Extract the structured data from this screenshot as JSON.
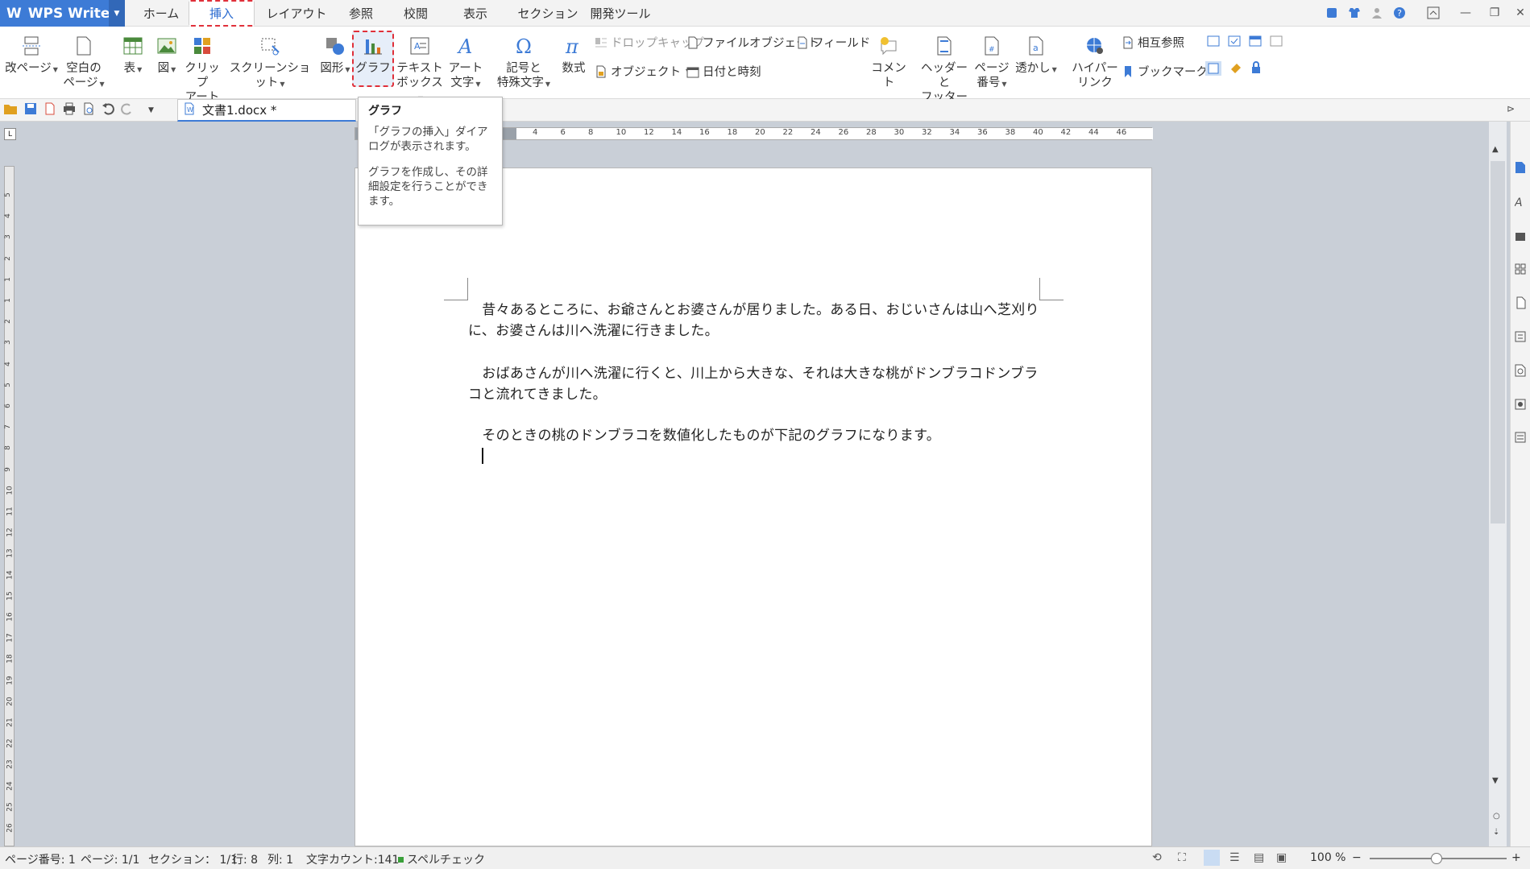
{
  "app": {
    "name": "WPS Writer"
  },
  "tabs": [
    "ホーム",
    "挿入",
    "レイアウト",
    "参照",
    "校閲",
    "表示",
    "セクション",
    "開発ツール"
  ],
  "ribbon": {
    "page_break": "改ページ",
    "blank_page_1": "空白の",
    "blank_page_2": "ページ",
    "table": "表",
    "picture": "図",
    "clipart_1": "クリップ",
    "clipart_2": "アート",
    "screenshot": "スクリーンショット",
    "shapes": "図形",
    "chart": "グラフ",
    "textbox_1": "テキスト",
    "textbox_2": "ボックス",
    "arttext_1": "アート",
    "arttext_2": "文字",
    "symbol_1": "記号と",
    "symbol_2": "特殊文字",
    "equation": "数式",
    "dropcap": "ドロップキャップ",
    "fileobject": "ファイルオブジェクト",
    "field": "フィールド",
    "object": "オブジェクト",
    "datetime": "日付と時刻",
    "comment": "コメント",
    "header_1": "ヘッダーと",
    "header_2": "フッター",
    "pagenum_1": "ページ",
    "pagenum_2": "番号",
    "watermark": "透かし",
    "hyperlink_1": "ハイパー",
    "hyperlink_2": "リンク",
    "crossref": "相互参照",
    "bookmark": "ブックマーク"
  },
  "document_tab": {
    "name": "文書1.docx *"
  },
  "tooltip": {
    "title": "グラフ",
    "line1": "「グラフの挿入」ダイアログが表示されます。",
    "line2": "グラフを作成し、その詳細設定を行うことができます。"
  },
  "document": {
    "p1": "　昔々あるところに、お爺さんとお婆さんが居りました。ある日、おじいさんは山へ芝刈りに、お婆さんは川へ洗濯に行きました。",
    "p2": "　おばあさんが川へ洗濯に行くと、川上から大きな、それは大きな桃がドンブラコドンブラコと流れてきました。",
    "p3": "　そのときの桃のドンブラコを数値化したものが下記のグラフになります。"
  },
  "ruler": {
    "h_ticks": [
      "4",
      "6",
      "8",
      "10",
      "12",
      "14",
      "16",
      "18",
      "20",
      "22",
      "24",
      "26",
      "28",
      "30",
      "32",
      "34",
      "36",
      "38",
      "40",
      "42",
      "44",
      "46"
    ],
    "v_ticks": [
      "5",
      "4",
      "3",
      "2",
      "1",
      "1",
      "2",
      "3",
      "4",
      "5",
      "6",
      "7",
      "8",
      "9",
      "10",
      "11",
      "12",
      "13",
      "14",
      "15",
      "16",
      "17",
      "18",
      "19",
      "20",
      "21",
      "22",
      "23",
      "24",
      "25",
      "26"
    ]
  },
  "status": {
    "page_num": "ページ番号: 1",
    "page": "ページ: 1/1",
    "section": "セクション： 1/1",
    "row": "行: 8",
    "col": "列: 1",
    "wordcount": "文字カウント:141",
    "spellcheck": "スペルチェック",
    "zoom": "100 %"
  }
}
